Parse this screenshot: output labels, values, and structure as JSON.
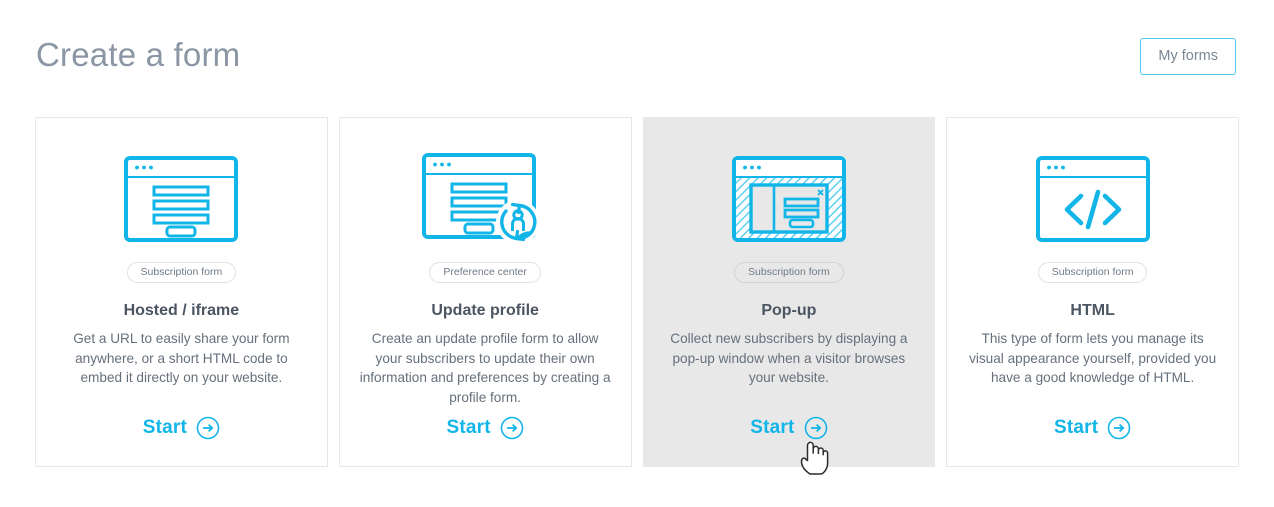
{
  "header": {
    "title": "Create a form",
    "my_forms_label": "My forms"
  },
  "colors": {
    "accent": "#12b5e8",
    "border_accent": "#4ec8ec",
    "title_text": "#8a96a3",
    "body_text": "#66707c",
    "card_border": "#e3eaef",
    "active_card_bg": "#e8e8e8"
  },
  "cards": [
    {
      "icon": "browser-form-icon",
      "badge": "Subscription form",
      "title": "Hosted / iframe",
      "description": "Get a URL to easily share your form anywhere, or a short HTML code to embed it directly on your website.",
      "start_label": "Start",
      "start_icon": "arrow-right-circle-icon",
      "active": false
    },
    {
      "icon": "browser-profile-update-icon",
      "badge": "Preference center",
      "title": "Update profile",
      "description": "Create an update profile form to allow your subscribers to update their own information and preferences by creating a profile form.",
      "start_label": "Start",
      "start_icon": "arrow-right-circle-icon",
      "active": false
    },
    {
      "icon": "browser-popup-icon",
      "badge": "Subscription form",
      "title": "Pop-up",
      "description": "Collect new subscribers by displaying a pop-up window when a visitor browses your website.",
      "start_label": "Start",
      "start_icon": "arrow-right-circle-icon",
      "active": true
    },
    {
      "icon": "browser-code-icon",
      "badge": "Subscription form",
      "title": "HTML",
      "description": "This type of form lets you manage its visual appearance yourself, provided you have a good knowledge of HTML.",
      "start_label": "Start",
      "start_icon": "arrow-right-circle-icon",
      "active": false
    }
  ],
  "cursor": {
    "icon": "pointing-hand-cursor"
  }
}
